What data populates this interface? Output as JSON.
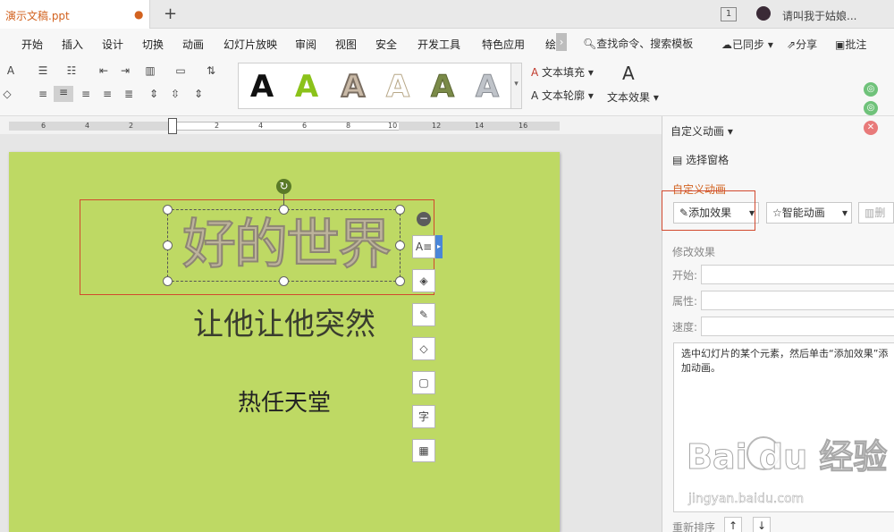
{
  "titlebar": {
    "doc_tab": "演示文稿.ppt",
    "modified_dot": "●",
    "new_tab": "+",
    "window_count": "1",
    "user": "请叫我于姑娘..."
  },
  "menu": {
    "items": [
      "开始",
      "插入",
      "设计",
      "切换",
      "动画",
      "幻灯片放映",
      "审阅",
      "视图",
      "安全",
      "开发工具",
      "特色应用",
      "绘"
    ],
    "more": "›",
    "search": "查找命令、搜索模板",
    "synced": "已同步",
    "share": "分享",
    "comment": "批注"
  },
  "ribbon": {
    "wordart_samples": [
      "A",
      "A",
      "A",
      "A",
      "A",
      "A"
    ],
    "text_fill": "文本填充",
    "text_outline": "文本轮廓",
    "text_effect": "文本效果",
    "effect_glyph": "A"
  },
  "ruler": {
    "numbers": [
      "6",
      "4",
      "2",
      "2",
      "4",
      "6",
      "8",
      "10",
      "12",
      "14",
      "16"
    ]
  },
  "slide": {
    "title": "好的世界",
    "subtitle1": "让他让他突然",
    "subtitle2": "热任天堂",
    "rotate_glyph": "↻",
    "minus_glyph": "−",
    "arrow_glyph": "▸"
  },
  "float_toolbar": {
    "wrap": "A≡",
    "layers": "◈",
    "brush": "✎",
    "fill": "◇",
    "border": "▢",
    "char": "字",
    "more": "▦"
  },
  "pane": {
    "header": "自定义动画 ▾",
    "select_pane": "选择窗格",
    "section_title": "自定义动画",
    "add_effect": "添加效果",
    "smart_animation": "智能动画",
    "delete": "删",
    "modify_effect": "修改效果",
    "start_label": "开始:",
    "property_label": "属性:",
    "speed_label": "速度:",
    "help_text": "选中幻灯片的某个元素，然后单击“添加效果”添加动画。",
    "reorder": "重新排序",
    "up": "↑",
    "down": "↓",
    "watermark": "Bai  du 经验",
    "watermark_url": "jingyan.baidu.com"
  },
  "colors": {
    "accent": "#d2621f",
    "slide_bg": "#bed964",
    "selection": "#d2492e",
    "section_title": "#d2621f"
  }
}
